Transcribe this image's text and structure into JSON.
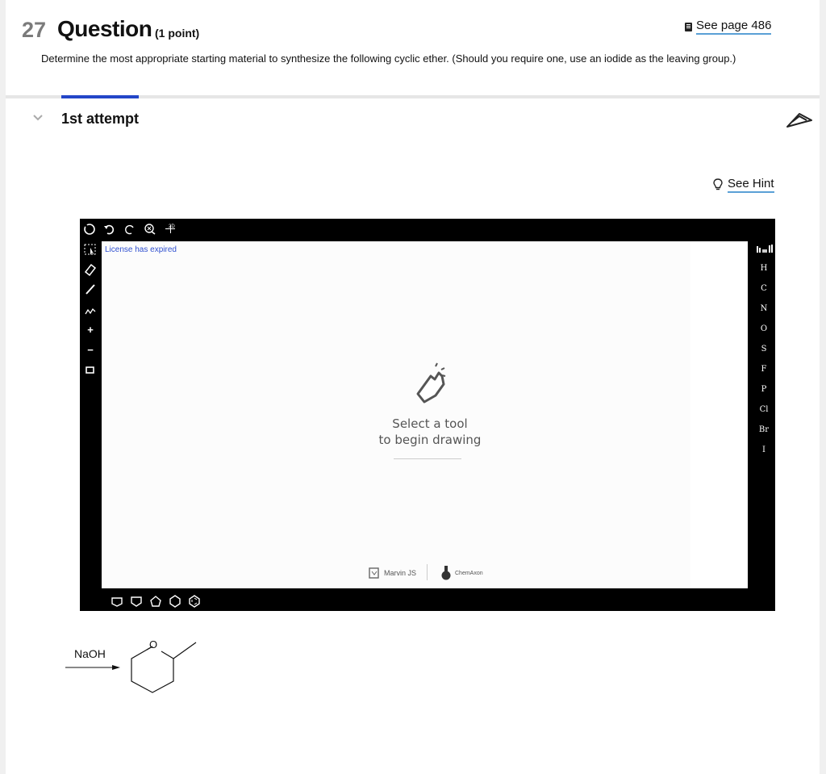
{
  "question": {
    "number": "27",
    "title": "Question",
    "points": "(1 point)",
    "see_page": "See page 486",
    "prompt": "Determine the most appropriate starting material to synthesize the following cyclic ether. (Should you require one, use an iodide as the leaving group.)"
  },
  "attempt": {
    "label": "1st attempt",
    "hint": "See Hint"
  },
  "editor": {
    "license_text": "License has expired",
    "empty_line1": "Select a tool",
    "empty_line2": "to begin drawing",
    "brand1": "Marvin JS",
    "brand2": "ChemAxon",
    "clean_label": "2D",
    "elements": [
      "H",
      "C",
      "N",
      "O",
      "S",
      "F",
      "P",
      "Cl",
      "Br",
      "I"
    ]
  },
  "reaction": {
    "reagent": "NaOH",
    "atom": "O"
  },
  "colors": {
    "tab_indicator": "#2346c8",
    "link_underline": "#5aa0d6",
    "license_text": "#3050d0"
  }
}
